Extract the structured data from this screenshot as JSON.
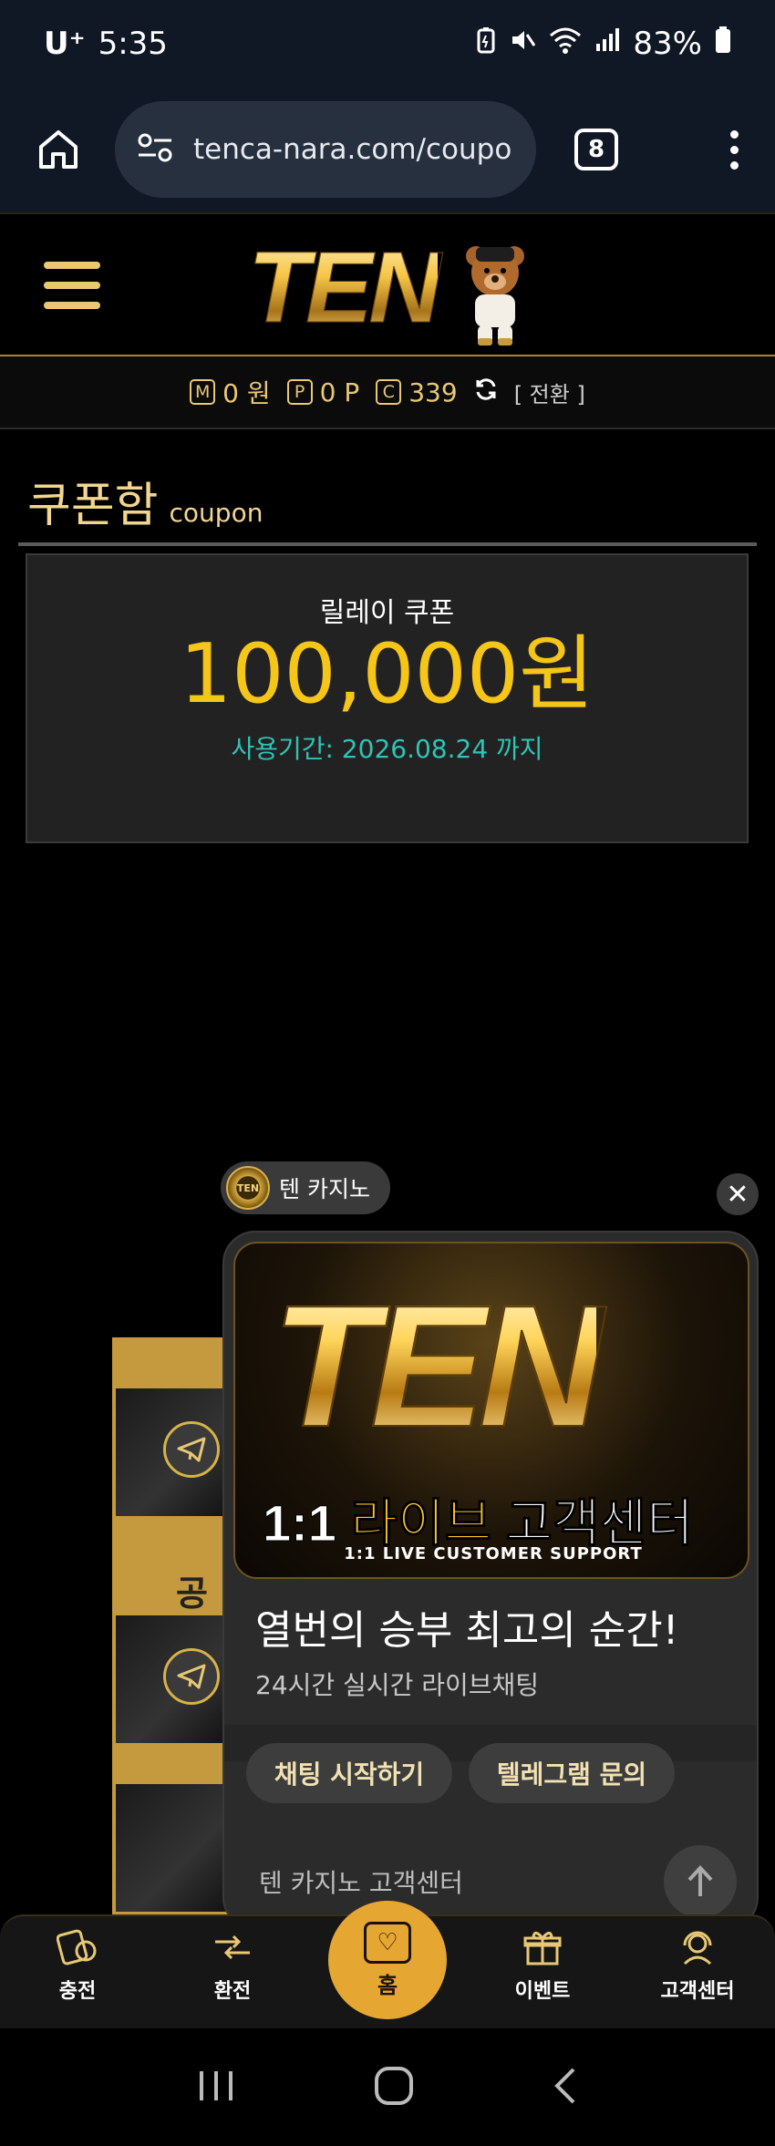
{
  "status_bar": {
    "carrier": "U⁺",
    "time": "5:35",
    "battery": "83%"
  },
  "browser": {
    "url": "tenca-nara.com/coupon",
    "tab_count": "8"
  },
  "site": {
    "logo_text": "TEN",
    "balances": [
      {
        "badge": "M",
        "value": "0 원"
      },
      {
        "badge": "P",
        "value": "0 P"
      },
      {
        "badge": "C",
        "value": "339"
      }
    ],
    "convert_label": "[ 전환 ]"
  },
  "page": {
    "title_kr": "쿠폰함",
    "title_en": "coupon"
  },
  "coupon": {
    "name": "릴레이 쿠폰",
    "amount": "100,000원",
    "period": "사용기간: 2026.08.24 까지"
  },
  "background_banners": {
    "label": "공식"
  },
  "chat": {
    "sender_name": "텐 카지노",
    "avatar_text": "TEN",
    "banner_ten": "TEN",
    "banner_ratio": "1:1",
    "banner_title": "라이브",
    "banner_title2": "고객센터",
    "banner_sub": "1:1 LIVE CUSTOMER SUPPORT",
    "heading": "열번의 승부 최고의 순간!",
    "subheading": "24시간 실시간 라이브채팅",
    "buttons": [
      "채팅 시작하기",
      "텔레그램 문의"
    ],
    "input_label": "텐 카지노 고객센터"
  },
  "bottom_nav": {
    "items": [
      "충전",
      "환전",
      "홈",
      "이벤트",
      "고객센터"
    ]
  },
  "colors": {
    "gold": "#e8c873",
    "amount_yellow": "#f5c518",
    "period_teal": "#2ec4b6",
    "home_orange": "#e6a732"
  }
}
